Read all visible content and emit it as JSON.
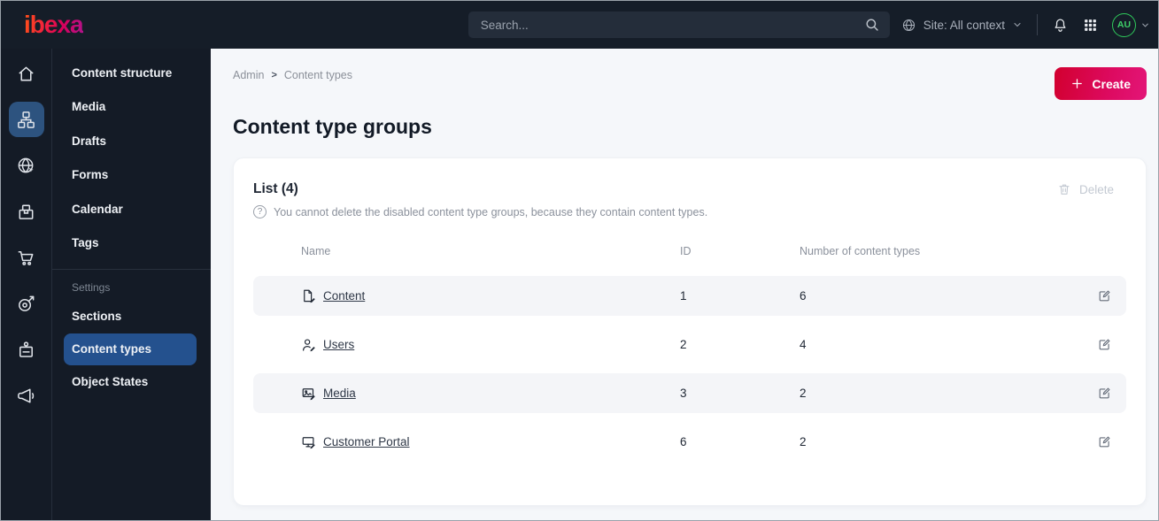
{
  "topbar": {
    "logo_text": "ibexa",
    "search_placeholder": "Search...",
    "site_selector": "Site: All context",
    "avatar_initials": "AU"
  },
  "sidebar": {
    "rail_icons": [
      "home",
      "content-tree",
      "site",
      "product-catalog",
      "commerce",
      "personalization",
      "subscriptions",
      "campaigns"
    ],
    "active_rail_index": 1,
    "items": [
      "Content structure",
      "Media",
      "Drafts",
      "Forms",
      "Calendar",
      "Tags"
    ],
    "settings_header": "Settings",
    "settings_items": [
      "Sections",
      "Content types",
      "Object States"
    ],
    "active_item": "Content types"
  },
  "page": {
    "breadcrumb": [
      "Admin",
      "Content types"
    ],
    "breadcrumb_separator": ">",
    "title": "Content type groups",
    "create_button": "Create"
  },
  "list": {
    "heading": "List (4)",
    "help_text": "You cannot delete the disabled content type groups, because they contain content types.",
    "delete_button": "Delete",
    "columns": [
      "Name",
      "ID",
      "Number of content types"
    ],
    "rows": [
      {
        "icon": "content-file",
        "name": "Content",
        "id": "1",
        "count": "6"
      },
      {
        "icon": "user",
        "name": "Users",
        "id": "2",
        "count": "4"
      },
      {
        "icon": "image",
        "name": "Media",
        "id": "3",
        "count": "2"
      },
      {
        "icon": "monitor",
        "name": "Customer Portal",
        "id": "6",
        "count": "2"
      }
    ]
  },
  "colors": {
    "topbar_bg": "#151d28",
    "sidebar_bg": "#141b26",
    "menu_active_blue": "#24518e",
    "rail_active_blue": "#2d537f",
    "create_gradient_start": "#d2002f",
    "create_gradient_end": "#e31678",
    "brand_gradient_start": "#ff5317",
    "brand_gradient_end": "#b0148e",
    "avatar_green": "#2fca5b",
    "page_bg": "#f5f7fa",
    "row_stripe": "#f4f5f8"
  }
}
